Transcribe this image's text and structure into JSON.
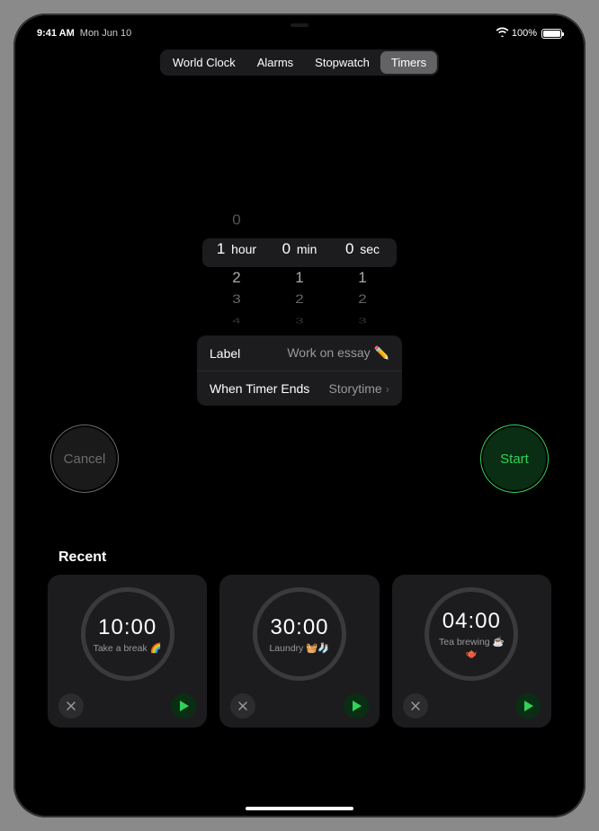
{
  "status": {
    "time": "9:41 AM",
    "date": "Mon Jun 10",
    "battery": "100%"
  },
  "tabs": {
    "world_clock": "World Clock",
    "alarms": "Alarms",
    "stopwatch": "Stopwatch",
    "timers": "Timers"
  },
  "picker": {
    "hour_above": "0",
    "hour_sel": "1",
    "hour_b1": "2",
    "hour_b2": "3",
    "hour_b3": "4",
    "hour_unit": "hour",
    "min_sel": "0",
    "min_b1": "1",
    "min_b2": "2",
    "min_b3": "3",
    "min_unit": "min",
    "sec_sel": "0",
    "sec_b1": "1",
    "sec_b2": "2",
    "sec_b3": "3",
    "sec_unit": "sec"
  },
  "settings": {
    "label_key": "Label",
    "label_val": "Work on essay ✏️",
    "ends_key": "When Timer Ends",
    "ends_val": "Storytime"
  },
  "buttons": {
    "cancel": "Cancel",
    "start": "Start"
  },
  "recent_header": "Recent",
  "recents": [
    {
      "time": "10:00",
      "label": "Take a break 🌈"
    },
    {
      "time": "30:00",
      "label": "Laundry 🧺🧦"
    },
    {
      "time": "04:00",
      "label": "Tea brewing ☕️ 🫖"
    }
  ]
}
